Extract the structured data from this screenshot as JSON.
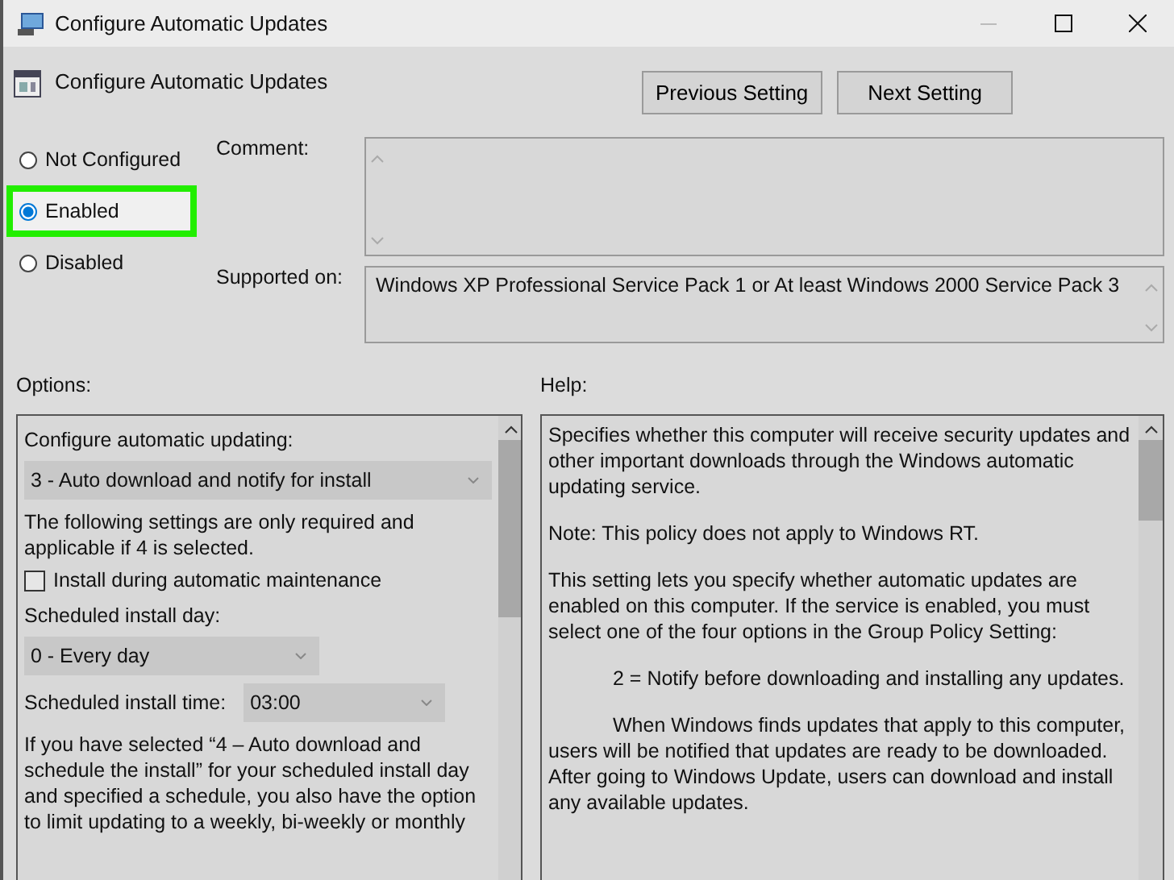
{
  "window": {
    "title": "Configure Automatic Updates"
  },
  "header": {
    "title": "Configure Automatic Updates",
    "buttons": [
      "Previous Setting",
      "Next Setting"
    ]
  },
  "state_options": [
    {
      "label": "Not Configured",
      "selected": false,
      "highlighted": false
    },
    {
      "label": "Enabled",
      "selected": true,
      "highlighted": true
    },
    {
      "label": "Disabled",
      "selected": false,
      "highlighted": false
    }
  ],
  "comment": {
    "label": "Comment:"
  },
  "supported_on": {
    "label": "Supported on:",
    "value": "Windows XP Professional Service Pack 1 or At least Windows 2000 Service Pack 3"
  },
  "options": {
    "label": "Options:",
    "items": [
      {
        "kind": "label",
        "text": "Configure automatic updating:"
      },
      {
        "kind": "dropdown",
        "value": "3 - Auto download and notify for install",
        "wide": true
      },
      {
        "kind": "text",
        "text": "The following settings are only required and applicable if 4 is selected."
      },
      {
        "kind": "checkbox",
        "text": "Install during automatic maintenance",
        "checked": false
      },
      {
        "kind": "label",
        "text": "Scheduled install day:"
      },
      {
        "kind": "dropdown",
        "value": "0 - Every day",
        "wide": false
      },
      {
        "kind": "labeled_dropdown",
        "text": "Scheduled install time:",
        "value": "03:00"
      },
      {
        "kind": "text",
        "text": "If you have selected “4 – Auto download and schedule the install” for your scheduled install day and specified a schedule, you also have the option to limit updating to a weekly, bi-weekly or monthly"
      }
    ]
  },
  "help": {
    "label": "Help:",
    "paragraphs": [
      {
        "text": "Specifies whether this computer will receive security updates and other important downloads through the Windows automatic updating service.",
        "indent": false
      },
      {
        "text": "Note: This policy does not apply to Windows RT.",
        "indent": false
      },
      {
        "text": "This setting lets you specify whether automatic updates are enabled on this computer. If the service is enabled, you must select one of the four options in the Group Policy Setting:",
        "indent": false
      },
      {
        "text": "2 = Notify before downloading and installing any updates.",
        "indent": true
      },
      {
        "text": "When Windows finds updates that apply to this computer, users will be notified that updates are ready to be downloaded. After going to Windows Update, users can download and install any available updates.",
        "indent": true
      }
    ]
  }
}
